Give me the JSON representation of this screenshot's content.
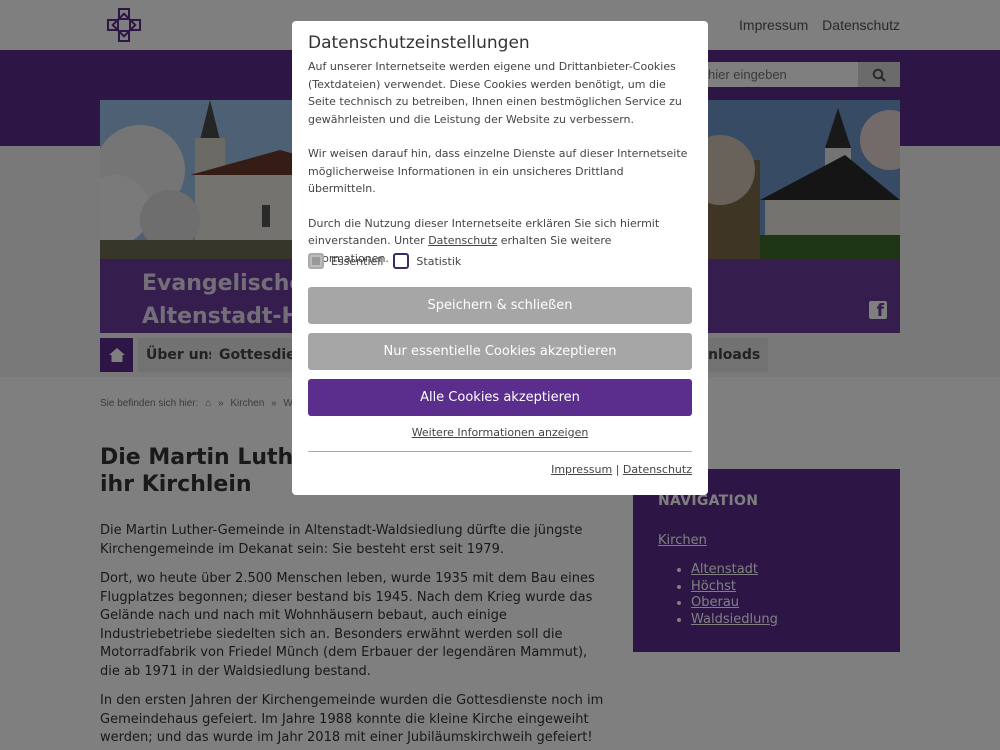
{
  "topbar": {
    "links": [
      "Impressum",
      "Datenschutz"
    ]
  },
  "search": {
    "placeholder": "hier eingeben"
  },
  "site": {
    "title_line1": "Evangelische K",
    "title_line2": "Altenstadt-Höc"
  },
  "nav": {
    "items": [
      "Über uns",
      "Gottesdien...",
      "nloads"
    ]
  },
  "breadcrumb": {
    "prefix": "Sie befinden sich hier:",
    "items": [
      "Kirchen",
      "Waldsied"
    ]
  },
  "page": {
    "title_line1": "Die Martin Luther-",
    "title_line2": "ihr Kirchlein"
  },
  "article": {
    "p1": "Die Martin Luther-Gemeinde in Altenstadt-Waldsiedlung dürfte die jüngste Kirchengemeinde im Dekanat sein: Sie besteht erst seit 1979.",
    "p2": "Dort, wo heute über 2.500 Menschen leben, wurde 1935 mit dem Bau eines Flugplatzes begonnen; dieser bestand bis 1945. Nach dem Krieg wurde das Gelände nach und nach mit Wohnhäusern bebaut, auch einige Industriebetriebe siedelten sich an. Besonders erwähnt werden soll die Motorradfabrik von Friedel Münch (dem Erbauer der legendären Mammut), die ab 1971 in der Waldsiedlung bestand.",
    "p3": "In den ersten Jahren der Kirchengemeinde wurden die Gottesdienste noch im Gemeindehaus gefeiert. Im Jahre 1988 konnte die kleine Kirche eingeweiht werden; und das wurde im Jahr 2018 mit einer Jubiläumskirchweih gefeiert!"
  },
  "sidebar": {
    "title": "NAVIGATION",
    "parent": "Kirchen",
    "items": [
      "Altenstadt",
      "Höchst",
      "Oberau",
      "Waldsiedlung"
    ]
  },
  "modal": {
    "title": "Datenschutzeinstellungen",
    "text1": "Auf unserer Internetseite werden eigene und Drittanbieter-Cookies (Textdateien) verwendet. Diese Cookies werden benötigt, um die Seite technisch zu betreiben, Ihnen einen bestmöglichen Service zu gewährleisten und die Leistung der Website zu verbessern.",
    "text2": "Wir weisen darauf hin, dass einzelne Dienste auf dieser Internetseite möglicherweise Informationen in ein unsicheres Drittland übermitteln.",
    "text3a": "Durch die Nutzung dieser Internetseite erklären Sie sich hiermit einverstanden. Unter ",
    "text3_link": "Datenschutz",
    "text3b": " erhalten Sie weitere Informationen.",
    "check_essential": "Essentiell",
    "check_statistik": "Statistik",
    "btn_save": "Speichern & schließen",
    "btn_essential": "Nur essentielle Cookies akzeptieren",
    "btn_all": "Alle Cookies akzeptieren",
    "more_info": "Weitere Informationen anzeigen",
    "footer_impressum": "Impressum",
    "footer_sep": " | ",
    "footer_datenschutz": "Datenschutz"
  }
}
